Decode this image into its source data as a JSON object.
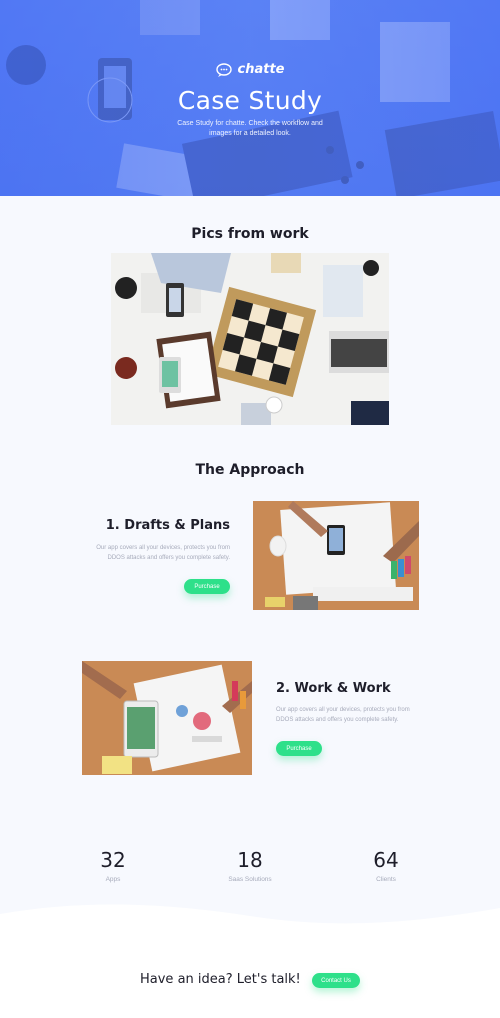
{
  "hero": {
    "logo_text": "chatte",
    "title": "Case Study",
    "subtitle": "Case Study for chatte. Check the workflow and images for a detailed look."
  },
  "pics": {
    "title": "Pics from work"
  },
  "approach": {
    "title": "The Approach",
    "steps": [
      {
        "title": "1. Drafts & Plans",
        "body": "Our app covers all your devices, protects you from DDOS attacks and offers you complete safety.",
        "button": "Purchase"
      },
      {
        "title": "2. Work & Work",
        "body": "Our app covers all your devices, protects you from DDOS attacks and offers you complete safety.",
        "button": "Purchase"
      }
    ]
  },
  "stats": [
    {
      "value": "32",
      "label": "Apps"
    },
    {
      "value": "18",
      "label": "Saas Solutions"
    },
    {
      "value": "64",
      "label": "Clients"
    }
  ],
  "cta": {
    "text": "Have an idea? Let's talk!",
    "button": "Contact Us"
  },
  "colors": {
    "hero_blue": "#5a82f4",
    "accent_green": "#2ee08a",
    "page_bg": "#f7f9fe"
  }
}
